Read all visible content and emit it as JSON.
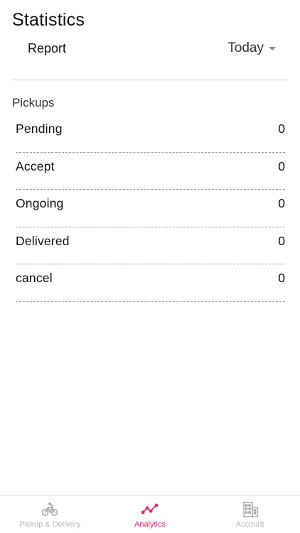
{
  "header": {
    "title": "Statistics",
    "report_label": "Report",
    "period": {
      "selected": "Today",
      "icon": "caret-down-icon"
    }
  },
  "pickups": {
    "section_title": "Pickups",
    "items": [
      {
        "label": "Pending",
        "value": "0"
      },
      {
        "label": "Accept",
        "value": "0"
      },
      {
        "label": "Ongoing",
        "value": "0"
      },
      {
        "label": "Delivered",
        "value": "0"
      },
      {
        "label": "cancel",
        "value": "0"
      }
    ]
  },
  "bottom_nav": {
    "active_color": "#e4286a",
    "inactive_color": "#b7b7b7",
    "items": [
      {
        "label": "Pickup & Delivery",
        "icon": "bicycle-icon",
        "active": false
      },
      {
        "label": "Analytics",
        "icon": "analytics-line-icon",
        "active": true
      },
      {
        "label": "Account",
        "icon": "building-icon",
        "active": false
      }
    ]
  }
}
